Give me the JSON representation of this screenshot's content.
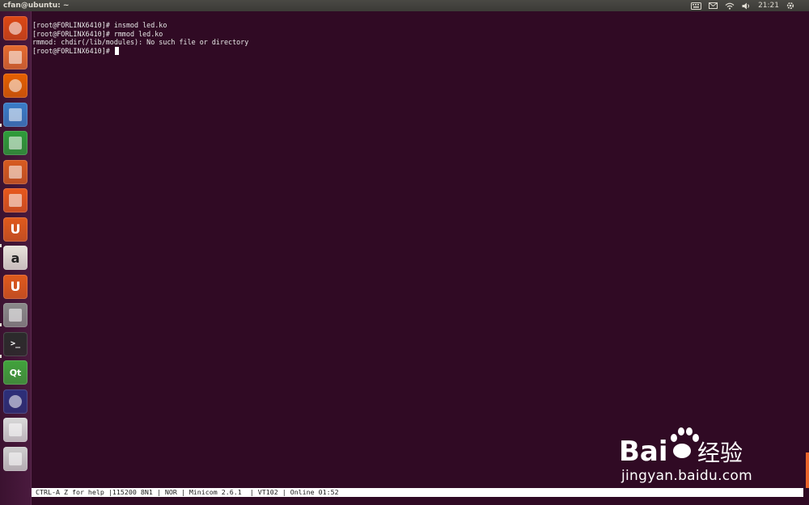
{
  "window": {
    "title": "cfan@ubuntu: ~"
  },
  "panel": {
    "clock": "21:21",
    "indicator_icons": [
      "keyboard-icon",
      "mail-icon",
      "wifi-icon",
      "volume-icon",
      "power-gear-icon"
    ]
  },
  "launcher": {
    "items": [
      {
        "name": "dash-home-icon",
        "label": "",
        "color": "#dd4814"
      },
      {
        "name": "files-icon",
        "label": "",
        "color": "#e56b2f"
      },
      {
        "name": "firefox-icon",
        "label": "",
        "color": "#e66000"
      },
      {
        "name": "libreoffice-writer-icon",
        "label": "",
        "color": "#3a7dc9"
      },
      {
        "name": "libreoffice-calc-icon",
        "label": "",
        "color": "#2e9d3a"
      },
      {
        "name": "libreoffice-impress-icon",
        "label": "",
        "color": "#d85b1f"
      },
      {
        "name": "software-center-icon",
        "label": "",
        "color": "#e8581c"
      },
      {
        "name": "ubuntu-one-icon",
        "label": "U",
        "color": "#e05a1c"
      },
      {
        "name": "amazon-icon",
        "label": "a",
        "color": "#e8e4dc"
      },
      {
        "name": "ubuntu-one-music-icon",
        "label": "U",
        "color": "#e05a1c"
      },
      {
        "name": "system-settings-icon",
        "label": "",
        "color": "#8a8a8a"
      },
      {
        "name": "terminal-icon",
        "label": ">_",
        "color": "#2b2b2b"
      },
      {
        "name": "qt-creator-icon",
        "label": "Qt",
        "color": "#41a33c"
      },
      {
        "name": "eclipse-icon",
        "label": "",
        "color": "#2c2f7a"
      },
      {
        "name": "text-editor-icon",
        "label": "",
        "color": "#d9d9d9"
      },
      {
        "name": "stacked-minimized-icon",
        "label": "",
        "color": "#cfcfcf"
      }
    ]
  },
  "terminal": {
    "lines": [
      "[root@FORLINX6410]# insmod led.ko",
      "[root@FORLINX6410]# rmmod led.ko",
      "rmmod: chdir(/lib/modules): No such file or directory",
      "[root@FORLINX6410]# "
    ]
  },
  "statusbar": {
    "text": "CTRL-A Z for help |115200 8N1 | NOR | Minicom 2.6.1  | VT102 | Online 01:52"
  },
  "watermark": {
    "logo_text": "Baidu经验",
    "url": "jingyan.baidu.com"
  }
}
